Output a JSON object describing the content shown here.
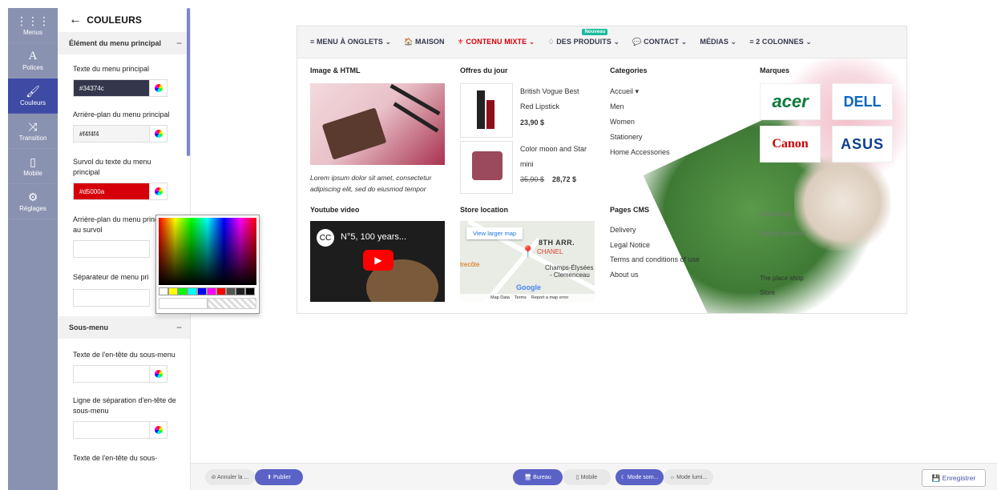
{
  "rail": {
    "items": [
      {
        "label": "Menus",
        "icon": "grid-icon"
      },
      {
        "label": "Polices",
        "icon": "font-icon"
      },
      {
        "label": "Couleurs",
        "icon": "brush-icon"
      },
      {
        "label": "Transition",
        "icon": "shuffle-icon"
      },
      {
        "label": "Mobile",
        "icon": "mobile-icon"
      },
      {
        "label": "Réglages",
        "icon": "gear-icon"
      }
    ]
  },
  "panel": {
    "title": "COULEURS",
    "section1": "Élément du menu principal",
    "section2": "Sous-menu",
    "fields": [
      {
        "label": "Texte du menu principal",
        "value": "#34374c",
        "color": "#34374c",
        "text_color": "#ffffff"
      },
      {
        "label": "Arrière-plan du menu principal",
        "value": "#f4f4f4",
        "color": "#f4f4f4",
        "text_color": "#222222"
      },
      {
        "label": "Survol du texte du menu principal",
        "value": "#d5000a",
        "color": "#d5000a",
        "text_color": "#ffffff"
      },
      {
        "label": "Arrière-plan du menu principal au survol",
        "value": ""
      },
      {
        "label": "Séparateur de menu pri",
        "value": ""
      }
    ],
    "sub_fields": [
      {
        "label": "Texte de l'en-tête du sous-menu",
        "value": ""
      },
      {
        "label": "Ligne de séparation d'en-tête de sous-menu",
        "value": ""
      },
      {
        "label": "Texte de l'en-tête du sous-",
        "value": ""
      }
    ]
  },
  "menu": {
    "items": [
      "≡ MENU À ONGLETS ⌄",
      "🏠 MAISON",
      "⚜ CONTENU MIXTE ⌄",
      "♢ DES PRODUITS ⌄",
      "💬 CONTACT ⌄",
      "MÉDIAS ⌄",
      "≡ 2 COLONNES ⌄"
    ],
    "badge": "Nouveau"
  },
  "content": {
    "col1_title": "Image & HTML",
    "lorem": "Lorem ipsum dolor sit amet, consectetur adipiscing elit, sed do eiusmod tempor",
    "youtube_title": "Youtube video",
    "video_title": "N°5, 100 years...",
    "col2_title": "Offres du jour",
    "product1_name_a": "British Vogue Best",
    "product1_name_b": "Red Lipstick",
    "product1_price": "23,90 $",
    "product2_name_a": "Color moon and Star",
    "product2_name_b": "mini",
    "product2_old": "35,90 $",
    "product2_price": "28,72 $",
    "store_title": "Store location",
    "map_btn": "View larger map",
    "map_labels": [
      "8TH ARR.",
      "CHANEL",
      "Champs-Élysées",
      "- Clemenceau",
      "trecôte",
      "Google",
      "Map Data",
      "Terms",
      "Report a map error"
    ],
    "col3_title": "Categories",
    "categories": [
      "Accueil ▾",
      "Men",
      "Women",
      "Stationery",
      "Home Accessories"
    ],
    "cms_title": "Pages CMS",
    "cms": [
      "Delivery",
      "Legal Notice",
      "Terms and conditions of use",
      "About us"
    ],
    "col4_title": "Marques",
    "brands": [
      "acer",
      "DELL",
      "Canon",
      "ASUS"
    ],
    "bottom_right": [
      "Prestashop",
      "Secure payment",
      "The place shop",
      "Store"
    ]
  },
  "bottombar": {
    "cancel": "⊘ Annuler la ...",
    "publish": "⬆ Publier",
    "desktop": "🖥 Bureau",
    "mobile": "▯ Mobile",
    "dark": "☾ Mode som...",
    "light": "☼ Mode lumi...",
    "save": "💾 Enregistrer"
  }
}
